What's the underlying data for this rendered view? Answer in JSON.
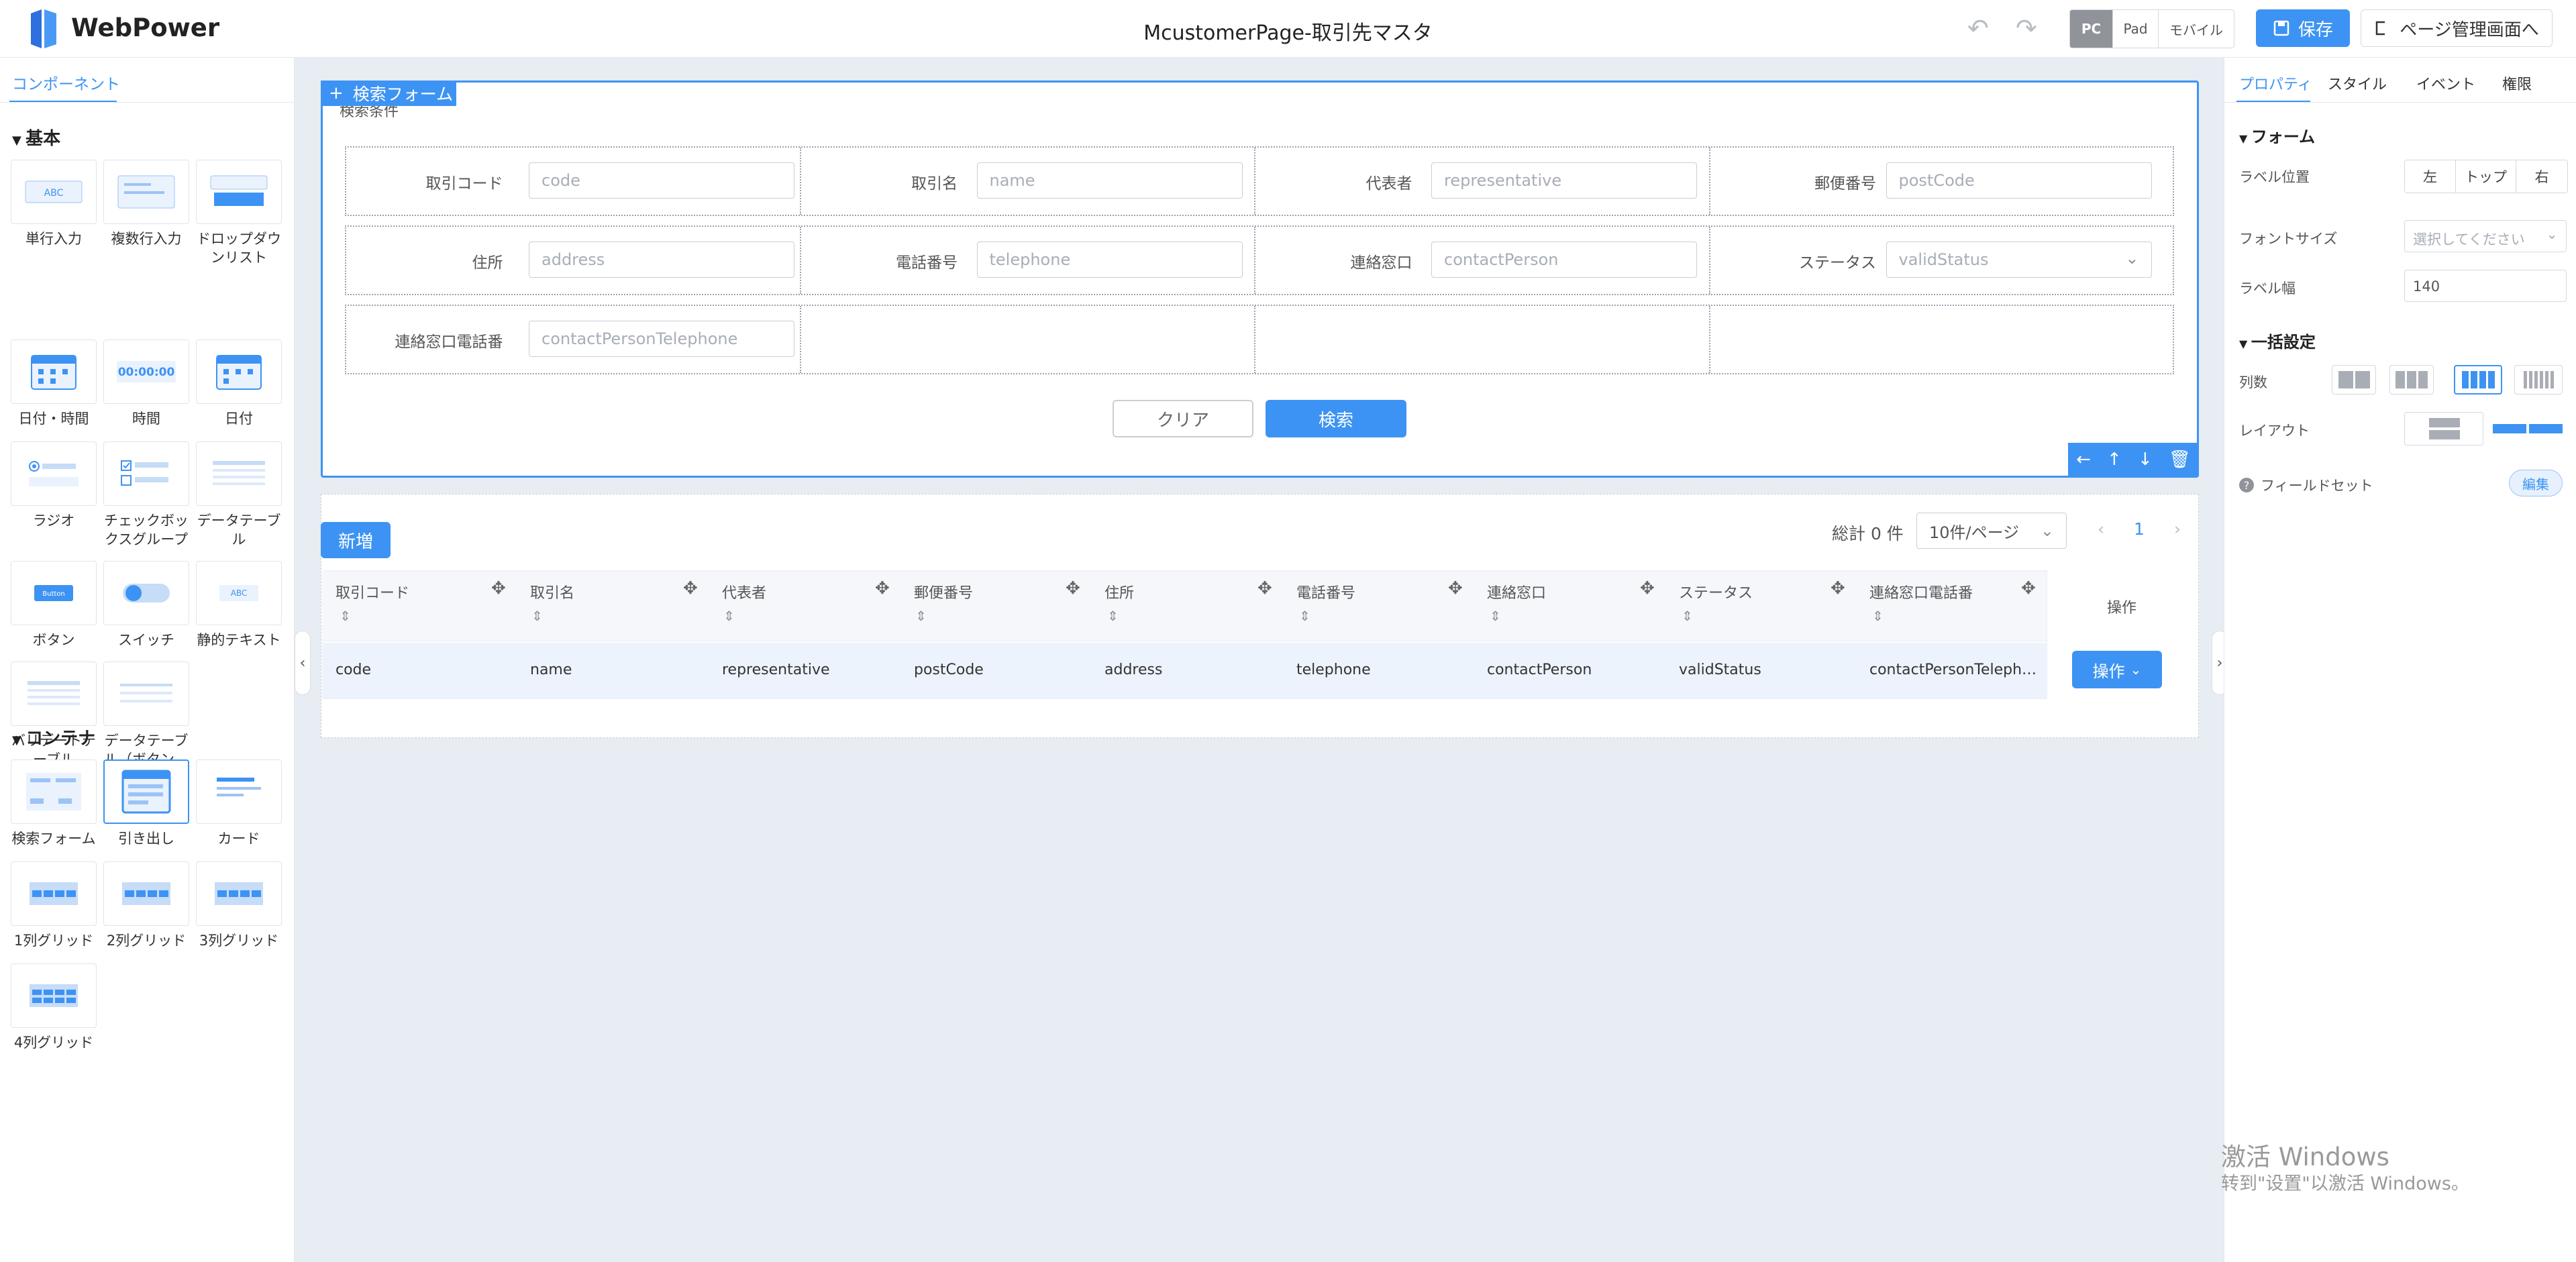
{
  "header": {
    "brand": "WebPower",
    "title": "McustomerPage-取引先マスタ",
    "undo_icon": "↶",
    "redo_icon": "↷",
    "devices": [
      "PC",
      "Pad",
      "モバイル"
    ],
    "save": "保存",
    "goto": "ページ管理画面へ"
  },
  "left": {
    "tab": "コンポーネント",
    "section_basic": "基本",
    "section_container": "コンテナ",
    "basic": [
      "単行入力",
      "複数行入力",
      "ドロップダウンリスト",
      "日付・時間",
      "時間",
      "日付",
      "ラジオ",
      "チェックボックスグループ",
      "データテーブル",
      "ボタン",
      "スイッチ",
      "静的テキスト",
      "バリデートテーブル",
      "データテーブル（ボタン…"
    ],
    "container": [
      "検索フォーム",
      "引き出し",
      "カード",
      "1列グリッド",
      "2列グリッド",
      "3列グリッド",
      "4列グリッド"
    ],
    "thumb_text": {
      "abc": "ABC",
      "time": "00:00:00",
      "button": "Button",
      "static": "ABC"
    }
  },
  "form": {
    "tag": "検索フォーム",
    "caption": "検索条件",
    "fields": [
      {
        "label": "取引コード",
        "placeholder": "code"
      },
      {
        "label": "取引名",
        "placeholder": "name"
      },
      {
        "label": "代表者",
        "placeholder": "representative"
      },
      {
        "label": "郵便番号",
        "placeholder": "postCode"
      },
      {
        "label": "住所",
        "placeholder": "address"
      },
      {
        "label": "電話番号",
        "placeholder": "telephone"
      },
      {
        "label": "連絡窓口",
        "placeholder": "contactPerson"
      },
      {
        "label": "ステータス",
        "placeholder": "validStatus"
      },
      {
        "label": "連絡窓口電話番",
        "placeholder": "contactPersonTelephone"
      }
    ],
    "clear": "クリア",
    "search": "検索",
    "tools": [
      "←",
      "↑",
      "↓",
      "🗑"
    ]
  },
  "table": {
    "new": "新増",
    "total": "総計 0 件",
    "page_size": "10件/ページ",
    "page": "1",
    "prev": "‹",
    "next": "›",
    "headers": [
      "取引コード",
      "取引名",
      "代表者",
      "郵便番号",
      "住所",
      "電話番号",
      "連絡窓口",
      "ステータス",
      "連絡窓口電話番",
      "操作"
    ],
    "row": [
      "code",
      "name",
      "representative",
      "postCode",
      "address",
      "telephone",
      "contactPerson",
      "validStatus",
      "contactPersonTeleph…"
    ],
    "op": "操作"
  },
  "right": {
    "tabs": [
      "プロパティ",
      "スタイル",
      "イベント",
      "権限"
    ],
    "sec_form": "フォーム",
    "label_pos": "ラベル位置",
    "label_pos_opts": [
      "左",
      "トップ",
      "右"
    ],
    "font_size": "フォントサイズ",
    "font_size_ph": "選択してください",
    "label_width": "ラベル幅",
    "label_width_val": "140",
    "sec_batch": "一括設定",
    "cols": "列数",
    "layout": "レイアウト",
    "fieldset": "フィールドセット",
    "edit": "編集"
  },
  "watermark": {
    "line1": "激活 Windows",
    "line2": "转到\"设置\"以激活 Windows。"
  },
  "colors": {
    "accent": "#3d93f3"
  }
}
